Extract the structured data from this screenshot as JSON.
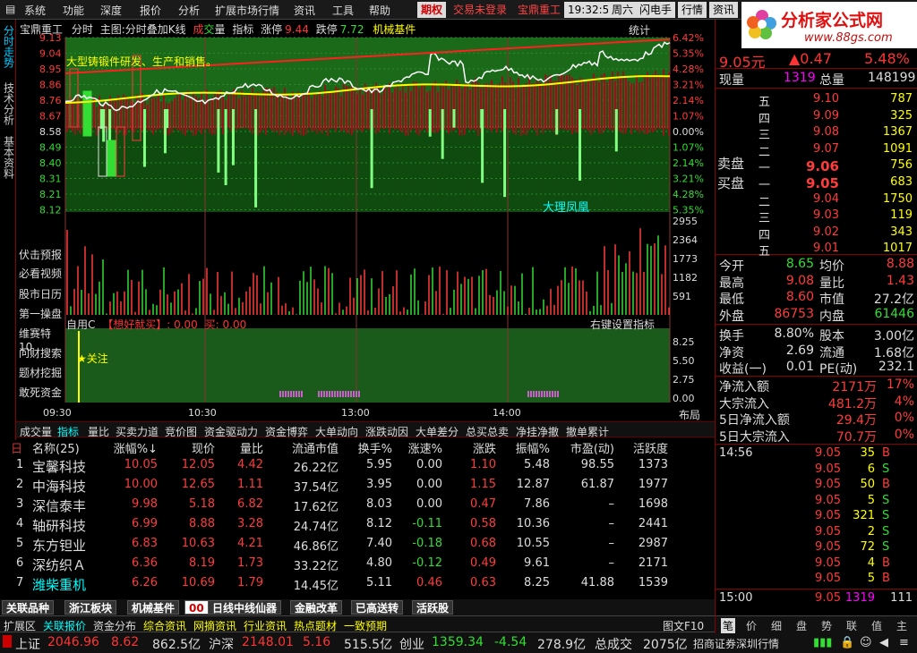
{
  "menu": [
    "系统",
    "功能",
    "深度",
    "报价",
    "分析",
    "扩展市场行情",
    "资讯",
    "工具",
    "帮助"
  ],
  "header_btns": {
    "qiquan": "期权",
    "login": "交易未登录",
    "stock": "宝鼎重工",
    "time": "19:32:55",
    "weekday": "周六",
    "flash": "闪电手",
    "quote": "行情",
    "news": "资讯"
  },
  "logo": {
    "name": "分析家公式网",
    "url": "www.88gs.com"
  },
  "left_tabs": [
    "分时走势",
    "技术分析",
    "基本资料"
  ],
  "chart": {
    "stock": "宝鼎重工",
    "mode": "分时",
    "main": "主图:分时叠加K线",
    "vol_red": "成",
    "vol_green": "交",
    "vol_rest": "量",
    "indicator": "指标",
    "limit_up_label": "涨停",
    "limit_up": "9.44",
    "limit_down_label": "跌停",
    "limit_down": "7.72",
    "sector": "机械基件",
    "stats": "统计",
    "annotation": "大型铸锻件研发、生产和销售。",
    "watermark": "大理凤凰",
    "price_ticks": [
      "9.13",
      "9.04",
      "8.95",
      "8.86",
      "8.76",
      "8.67",
      "8.58",
      "8.49",
      "8.40",
      "8.31",
      "8.21",
      "8.12"
    ],
    "pct_ticks": [
      "6.42%",
      "5.35%",
      "4.28%",
      "3.21%",
      "2.14%",
      "1.07%",
      "0.00%",
      "1.07%",
      "2.14%",
      "3.21%",
      "4.28%",
      "5.35%"
    ],
    "vol_ticks": [
      "2955",
      "2364",
      "1773",
      "1182",
      "591"
    ],
    "sub_ticks": [
      "8.25",
      "5.50",
      "2.75",
      "0.00"
    ],
    "time_ticks": [
      "09:30",
      "10:30",
      "13:00",
      "14:00"
    ],
    "sub_title": "自用C",
    "sub_name": "【想好就买】",
    "sub_val": ": 0.00",
    "sub_buy": "买: 0.00",
    "sub_hint": "右键设置指标",
    "follow": "★关注",
    "layout_btn": "布局"
  },
  "indicator_list": [
    "伏击预报",
    "必看视频",
    "股市日历",
    "第一操盘",
    "维赛特10",
    "问财搜索",
    "题材挖掘",
    "敢死资金"
  ],
  "bottom_tabs": [
    "成交量",
    "指标",
    "量比",
    "买卖力道",
    "竞价图",
    "资金驱动力",
    "资金博弈",
    "大单动向",
    "涨跌动因",
    "大单差分",
    "总买总卖",
    "净挂净撤",
    "撤单累计"
  ],
  "table": {
    "headers": [
      "名称(25)",
      "涨幅%↓",
      "现价",
      "量比",
      "流通市值",
      "换手%",
      "涨速%",
      "涨跌",
      "振幅%",
      "市盈(动)",
      "活跃度"
    ],
    "rows": [
      [
        "1",
        "宝馨科技",
        "10.05",
        "12.05",
        "4.42",
        "26.22亿",
        "5.95",
        "0.00",
        "1.10",
        "5.48",
        "98.55",
        "1373"
      ],
      [
        "2",
        "中海科技",
        "10.00",
        "12.65",
        "1.11",
        "37.54亿",
        "3.95",
        "0.00",
        "1.15",
        "12.87",
        "61.87",
        "1977"
      ],
      [
        "3",
        "深信泰丰",
        "9.98",
        "5.18",
        "6.82",
        "17.62亿",
        "8.03",
        "0.00",
        "0.47",
        "7.86",
        "–",
        "1698"
      ],
      [
        "4",
        "轴研科技",
        "6.99",
        "8.88",
        "3.28",
        "24.74亿",
        "8.12",
        "-0.11",
        "0.58",
        "10.36",
        "–",
        "2441"
      ],
      [
        "5",
        "东方钽业",
        "6.83",
        "10.63",
        "4.21",
        "46.86亿",
        "7.40",
        "-0.18",
        "0.68",
        "10.55",
        "–",
        "2987"
      ],
      [
        "6",
        "深纺织Ａ",
        "6.36",
        "8.19",
        "1.73",
        "33.22亿",
        "4.80",
        "-0.12",
        "0.49",
        "9.61",
        "–",
        "2171"
      ],
      [
        "7",
        "潍柴重机",
        "6.26",
        "10.69",
        "1.79",
        "14.45亿",
        "5.11",
        "0.46",
        "0.63",
        "8.25",
        "41.88",
        "1539"
      ]
    ]
  },
  "sector_tabs": [
    "关联品种",
    "浙江板块",
    "机械基件",
    "00",
    "日线中线仙器",
    "金融改革",
    "已高送转",
    "活跃股"
  ],
  "bottom_bar": [
    "扩展区",
    "关联报价",
    "资金分布",
    "综合资讯",
    "网摘资讯",
    "行业资讯",
    "热点题材",
    "一致预期"
  ],
  "bottom_bar_right": "图文F10",
  "status": {
    "sh_label": "上证",
    "sh": "2046.96",
    "sh_chg": "8.62",
    "sh_amt": "862.5亿",
    "hs_label": "沪深",
    "hs": "2148.01",
    "hs_chg": "5.16",
    "hs_amt": "515.5亿",
    "cy_label": "创业",
    "cy": "1359.34",
    "cy_chg": "-4.54",
    "cy_amt": "278.9亿",
    "total_label": "总成交",
    "total": "2075亿",
    "broker": "招商证券深圳行情"
  },
  "quote": {
    "price": "9.05元",
    "change": "▲0.47",
    "pct": "5.48%",
    "now_label": "现量",
    "now": "1319",
    "total_label": "总量",
    "total": "148199",
    "sells": [
      [
        "五",
        "9.10",
        "787"
      ],
      [
        "四",
        "9.09",
        "325"
      ],
      [
        "三",
        "9.08",
        "1367"
      ],
      [
        "二",
        "9.07",
        "1091"
      ],
      [
        "一",
        "9.06",
        "756"
      ]
    ],
    "buys": [
      [
        "一",
        "9.05",
        "683"
      ],
      [
        "二",
        "9.04",
        "1750"
      ],
      [
        "三",
        "9.03",
        "119"
      ],
      [
        "四",
        "9.02",
        "343"
      ],
      [
        "五",
        "9.01",
        "1017"
      ]
    ],
    "sell_label": "卖盘",
    "buy_label": "买盘",
    "stats": [
      [
        "今开",
        "8.65",
        "均价",
        "8.88"
      ],
      [
        "最高",
        "9.08",
        "量比",
        "1.43"
      ],
      [
        "最低",
        "8.60",
        "市值",
        "27.2亿"
      ],
      [
        "外盘",
        "86753",
        "内盘",
        "61446"
      ]
    ],
    "stats2": [
      [
        "换手",
        "8.80%",
        "股本",
        "3.00亿"
      ],
      [
        "净资",
        "2.69",
        "流通",
        "1.68亿"
      ],
      [
        "收益(一)",
        "0.01",
        "PE(动)",
        "232.1"
      ]
    ],
    "flows": [
      [
        "净流入额",
        "2171万",
        "17%"
      ],
      [
        "大宗流入",
        "481.2万",
        "4%"
      ],
      [
        "5日净流入额",
        "29.4万",
        "0%"
      ],
      [
        "5日大宗流入",
        "70.7万",
        "0%"
      ]
    ],
    "tick_time1": "14:56",
    "tick_time2": "15:00",
    "ticks": [
      [
        "9.05",
        "35",
        "B"
      ],
      [
        "9.05",
        "6",
        "S"
      ],
      [
        "9.05",
        "50",
        "B"
      ],
      [
        "9.05",
        "5",
        "S"
      ],
      [
        "9.05",
        "321",
        "S"
      ],
      [
        "9.05",
        "2",
        "S"
      ],
      [
        "9.05",
        "72",
        "S"
      ],
      [
        "9.05",
        "4",
        "B"
      ],
      [
        "9.05",
        "5",
        "B"
      ]
    ],
    "last_tick": [
      "9.05",
      "1319",
      "111"
    ],
    "tabs": [
      "笔",
      "价",
      "细",
      "盘",
      "势",
      "联",
      "值",
      "主"
    ]
  },
  "colors": {
    "red": "#ff3b3b",
    "green": "#33dd33",
    "yellow": "#ffff00",
    "gold": "#ffcc00"
  }
}
